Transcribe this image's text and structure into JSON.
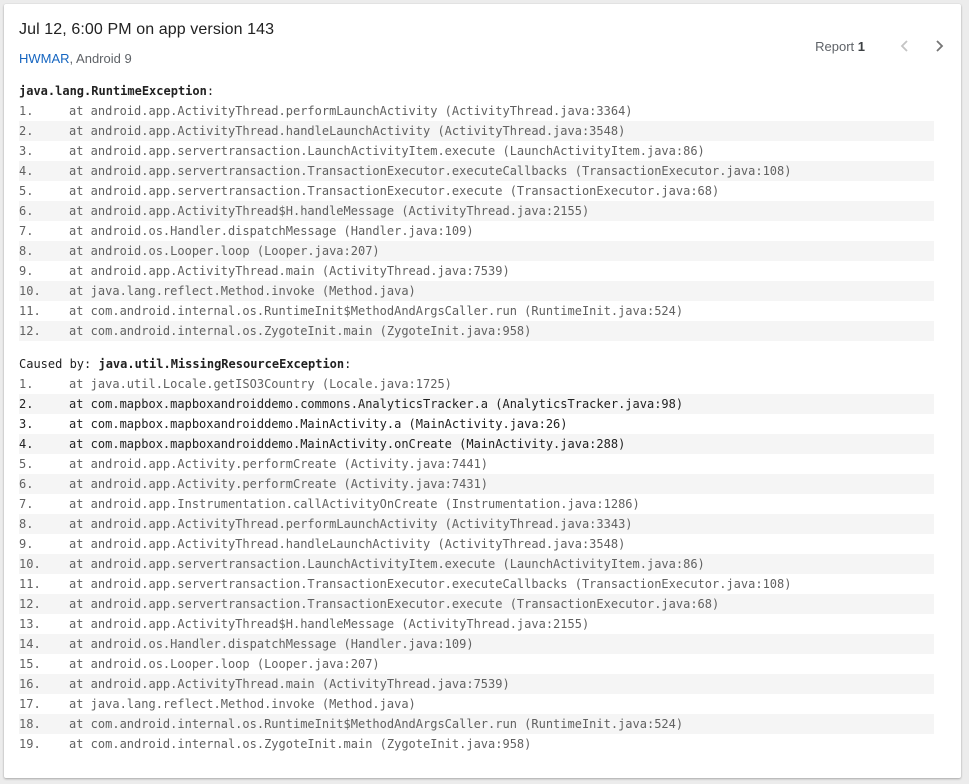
{
  "header": {
    "title": "Jul 12, 6:00 PM on app version 143",
    "device": "HWMAR",
    "os": ", Android 9",
    "report_label": "Report",
    "report_number": "1"
  },
  "trace": {
    "main_exception": "java.lang.RuntimeException",
    "main_frames": [
      {
        "n": "1.",
        "t": "at android.app.ActivityThread.performLaunchActivity (ActivityThread.java:3364)"
      },
      {
        "n": "2.",
        "t": "at android.app.ActivityThread.handleLaunchActivity (ActivityThread.java:3548)"
      },
      {
        "n": "3.",
        "t": "at android.app.servertransaction.LaunchActivityItem.execute (LaunchActivityItem.java:86)"
      },
      {
        "n": "4.",
        "t": "at android.app.servertransaction.TransactionExecutor.executeCallbacks (TransactionExecutor.java:108)"
      },
      {
        "n": "5.",
        "t": "at android.app.servertransaction.TransactionExecutor.execute (TransactionExecutor.java:68)"
      },
      {
        "n": "6.",
        "t": "at android.app.ActivityThread$H.handleMessage (ActivityThread.java:2155)"
      },
      {
        "n": "7.",
        "t": "at android.os.Handler.dispatchMessage (Handler.java:109)"
      },
      {
        "n": "8.",
        "t": "at android.os.Looper.loop (Looper.java:207)"
      },
      {
        "n": "9.",
        "t": "at android.app.ActivityThread.main (ActivityThread.java:7539)"
      },
      {
        "n": "10.",
        "t": "at java.lang.reflect.Method.invoke (Method.java)"
      },
      {
        "n": "11.",
        "t": "at com.android.internal.os.RuntimeInit$MethodAndArgsCaller.run (RuntimeInit.java:524)"
      },
      {
        "n": "12.",
        "t": "at com.android.internal.os.ZygoteInit.main (ZygoteInit.java:958)"
      }
    ],
    "caused_by_label": "Caused by: ",
    "cause_exception": "java.util.MissingResourceException",
    "cause_frames": [
      {
        "n": "1.",
        "t": "at java.util.Locale.getISO3Country (Locale.java:1725)"
      },
      {
        "n": "2.",
        "t": "at com.mapbox.mapboxandroiddemo.commons.AnalyticsTracker.a (AnalyticsTracker.java:98)",
        "app": true
      },
      {
        "n": "3.",
        "t": "at com.mapbox.mapboxandroiddemo.MainActivity.a (MainActivity.java:26)",
        "app": true
      },
      {
        "n": "4.",
        "t": "at com.mapbox.mapboxandroiddemo.MainActivity.onCreate (MainActivity.java:288)",
        "app": true
      },
      {
        "n": "5.",
        "t": "at android.app.Activity.performCreate (Activity.java:7441)"
      },
      {
        "n": "6.",
        "t": "at android.app.Activity.performCreate (Activity.java:7431)"
      },
      {
        "n": "7.",
        "t": "at android.app.Instrumentation.callActivityOnCreate (Instrumentation.java:1286)"
      },
      {
        "n": "8.",
        "t": "at android.app.ActivityThread.performLaunchActivity (ActivityThread.java:3343)"
      },
      {
        "n": "9.",
        "t": "at android.app.ActivityThread.handleLaunchActivity (ActivityThread.java:3548)"
      },
      {
        "n": "10.",
        "t": "at android.app.servertransaction.LaunchActivityItem.execute (LaunchActivityItem.java:86)"
      },
      {
        "n": "11.",
        "t": "at android.app.servertransaction.TransactionExecutor.executeCallbacks (TransactionExecutor.java:108)"
      },
      {
        "n": "12.",
        "t": "at android.app.servertransaction.TransactionExecutor.execute (TransactionExecutor.java:68)"
      },
      {
        "n": "13.",
        "t": "at android.app.ActivityThread$H.handleMessage (ActivityThread.java:2155)"
      },
      {
        "n": "14.",
        "t": "at android.os.Handler.dispatchMessage (Handler.java:109)"
      },
      {
        "n": "15.",
        "t": "at android.os.Looper.loop (Looper.java:207)"
      },
      {
        "n": "16.",
        "t": "at android.app.ActivityThread.main (ActivityThread.java:7539)"
      },
      {
        "n": "17.",
        "t": "at java.lang.reflect.Method.invoke (Method.java)"
      },
      {
        "n": "18.",
        "t": "at com.android.internal.os.RuntimeInit$MethodAndArgsCaller.run (RuntimeInit.java:524)"
      },
      {
        "n": "19.",
        "t": "at com.android.internal.os.ZygoteInit.main (ZygoteInit.java:958)"
      }
    ]
  },
  "icons": {
    "prev": "chevron-left-icon",
    "next": "chevron-right-icon"
  },
  "colors": {
    "device_link": "#1565c0",
    "stripe": "#f5f5f5",
    "frame_text": "#616161",
    "app_frame_text": "#212121"
  }
}
